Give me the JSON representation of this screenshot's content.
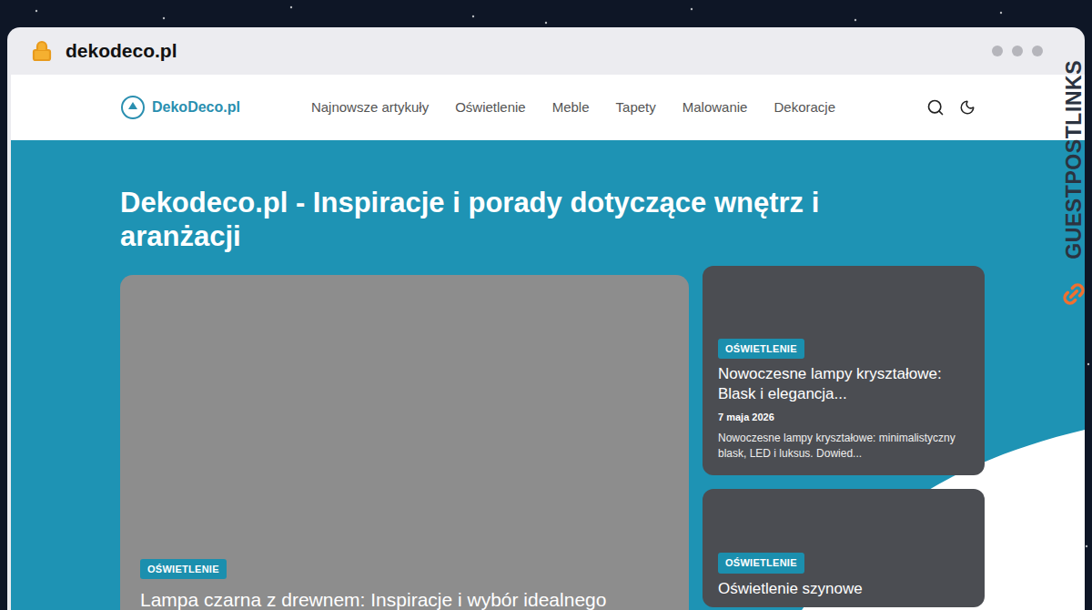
{
  "browser": {
    "url": "dekodeco.pl"
  },
  "watermark": "GUESTPOSTLINKS",
  "site": {
    "logo": "DekoDeco.pl",
    "nav": [
      "Najnowsze artykuły",
      "Oświetlenie",
      "Meble",
      "Tapety",
      "Malowanie",
      "Dekoracje"
    ],
    "heading": "Dekodeco.pl - Inspiracje i porady dotyczące wnętrz i aranżacji"
  },
  "featured": {
    "category": "OŚWIETLENIE",
    "title": "Lampa czarna z drewnem: Inspiracje i wybór idealnego"
  },
  "cards": [
    {
      "category": "OŚWIETLENIE",
      "title": "Nowoczesne lampy kryształowe: Blask i elegancja...",
      "date": "7 maja 2026",
      "excerpt": "Nowoczesne lampy kryształowe: minimalistyczny blask, LED i luksus. Dowied..."
    },
    {
      "category": "OŚWIETLENIE",
      "title": "Oświetlenie szynowe"
    }
  ]
}
